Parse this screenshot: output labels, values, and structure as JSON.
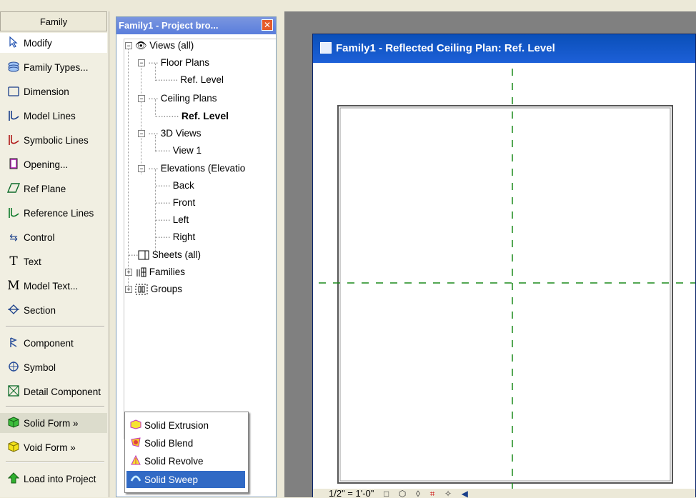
{
  "design_bar": {
    "header": "Family",
    "items": [
      {
        "label": "Modify",
        "icon": "arrow-pointer-icon"
      },
      {
        "label": "Family Types...",
        "icon": "family-types-icon"
      },
      {
        "label": "Dimension",
        "icon": "dimension-icon"
      },
      {
        "label": "Model Lines",
        "icon": "model-lines-icon"
      },
      {
        "label": "Symbolic Lines",
        "icon": "symbolic-lines-icon"
      },
      {
        "label": "Opening...",
        "icon": "opening-icon"
      },
      {
        "label": "Ref Plane",
        "icon": "ref-plane-icon"
      },
      {
        "label": "Reference Lines",
        "icon": "reference-lines-icon"
      },
      {
        "label": "Control",
        "icon": "control-arrows-icon"
      },
      {
        "label": "Text",
        "icon": "text-icon"
      },
      {
        "label": "Model Text...",
        "icon": "model-text-icon"
      },
      {
        "label": "Section",
        "icon": "section-icon"
      },
      {
        "label": "Component",
        "icon": "component-icon"
      },
      {
        "label": "Symbol",
        "icon": "symbol-icon"
      },
      {
        "label": "Detail Component",
        "icon": "detail-component-icon"
      },
      {
        "label": "Solid Form »",
        "icon": "solid-form-icon"
      },
      {
        "label": "Void Form »",
        "icon": "void-form-icon"
      },
      {
        "label": "Load into Project",
        "icon": "load-into-project-icon"
      }
    ]
  },
  "project_browser": {
    "title": "Family1 - Project bro...",
    "tree": {
      "views": "Views (all)",
      "floor_plans": "Floor Plans",
      "floor_ref": "Ref. Level",
      "ceiling_plans": "Ceiling Plans",
      "ceiling_ref": "Ref. Level",
      "views_3d": "3D Views",
      "view1": "View 1",
      "elevations": "Elevations (Elevatio",
      "back": "Back",
      "front": "Front",
      "left": "Left",
      "right": "Right",
      "sheets": "Sheets (all)",
      "families": "Families",
      "groups": "Groups"
    }
  },
  "flyout_menu": {
    "items": [
      "Solid Extrusion",
      "Solid Blend",
      "Solid Revolve",
      "Solid Sweep"
    ],
    "highlighted_index": 3
  },
  "view_window": {
    "title": "Family1 - Reflected Ceiling Plan: Ref. Level",
    "scale": "1/2\" = 1'-0\"",
    "accent_color": "#0a4fb8",
    "ref_plane_color": "#1a8a1a"
  }
}
